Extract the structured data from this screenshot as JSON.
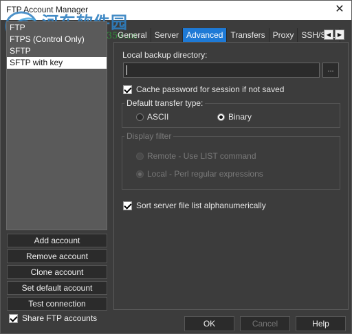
{
  "window": {
    "title": "FTP Account Manager",
    "close_glyph": "✕"
  },
  "watermark": {
    "logo_letter": "G",
    "brand": "河东软件园",
    "url": "www.pc0359.cn"
  },
  "accounts": {
    "items": [
      {
        "label": "FTP"
      },
      {
        "label": "FTPS (Control Only)"
      },
      {
        "label": "SFTP"
      },
      {
        "label": "SFTP with key"
      }
    ],
    "selected_index": 3
  },
  "left_buttons": {
    "add": "Add account",
    "remove": "Remove account",
    "clone": "Clone account",
    "set_default": "Set default account",
    "test": "Test connection"
  },
  "share": {
    "label": "Share FTP accounts",
    "checked": true
  },
  "tabs": {
    "items": [
      "General",
      "Server",
      "Advanced",
      "Transfers",
      "Proxy",
      "SSH/SSL"
    ],
    "active": "Advanced",
    "prev_glyph": "◀",
    "next_glyph": "▶"
  },
  "advanced": {
    "backup_dir_label": "Local backup directory:",
    "backup_dir_value": "",
    "browse_label": "...",
    "cache_password": {
      "label": "Cache password for session if not saved",
      "checked": true
    },
    "transfer_type": {
      "title": "Default transfer type:",
      "options": [
        "ASCII",
        "Binary"
      ],
      "selected": "Binary"
    },
    "display_filter": {
      "title": "Display filter",
      "options": [
        "Remote - Use LIST command",
        "Local - Perl regular expressions"
      ],
      "selected": "Local - Perl regular expressions",
      "enabled": false
    },
    "sort_alpha": {
      "label": "Sort server file list alphanumerically",
      "checked": true
    }
  },
  "dialog_buttons": {
    "ok": "OK",
    "cancel": "Cancel",
    "help": "Help"
  }
}
